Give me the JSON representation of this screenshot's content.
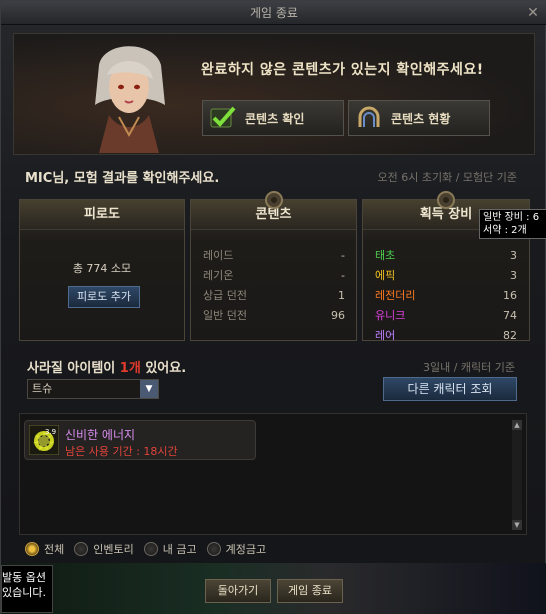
{
  "window": {
    "title": "게임 종료",
    "close_glyph": "✕"
  },
  "header": {
    "message": "완료하지 않은 콘텐츠가 있는지 확인해주세요!",
    "check_button": "콘텐츠 확인",
    "status_button": "콘텐츠 현황"
  },
  "summary": {
    "greeting": "MIC님, 모험 결과를 확인해주세요.",
    "reset_note": "오전 6시 초기화 / 모험단 기준"
  },
  "fatigue": {
    "title": "피로도",
    "usage_text": "총 774 소모",
    "add_button": "피로도 추가"
  },
  "content": {
    "title": "콘텐츠",
    "rows": [
      {
        "name": "레이드",
        "value": "-"
      },
      {
        "name": "레기온",
        "value": "-"
      },
      {
        "name": "상급 던전",
        "value": "1"
      },
      {
        "name": "일반 던전",
        "value": "96"
      }
    ]
  },
  "loot": {
    "title": "획득 장비",
    "rows": [
      {
        "name": "태초",
        "value": "3",
        "color": "#4fd04f"
      },
      {
        "name": "에픽",
        "value": "3",
        "color": "#f0c020"
      },
      {
        "name": "레전더리",
        "value": "16",
        "color": "#ff7a20"
      },
      {
        "name": "유니크",
        "value": "74",
        "color": "#e040e0"
      },
      {
        "name": "레어",
        "value": "82",
        "color": "#c080ff"
      }
    ]
  },
  "tooltip": {
    "line1": "일반 장비 : 6",
    "line2": "서약 : 2개"
  },
  "vanish": {
    "prefix": "사라질 아이템이 ",
    "count": "1개",
    "suffix": " 있어요.",
    "note": "3일내 / 캐릭터 기준",
    "select_value": "트슈",
    "other_char_button": "다른 캐릭터 조회"
  },
  "items": [
    {
      "name": "신비한 에너지",
      "time": "남은 사용 기간 : 18시간",
      "icon": "energy-orb-icon",
      "badge": "3.9"
    }
  ],
  "filters": [
    {
      "label": "전체",
      "selected": true
    },
    {
      "label": "인벤토리",
      "selected": false
    },
    {
      "label": "내 금고",
      "selected": false
    },
    {
      "label": "계정금고",
      "selected": false
    }
  ],
  "side_note": {
    "line1": "발동 옵션",
    "line2": "있습니다."
  },
  "footer": {
    "back_button": "돌아가기",
    "exit_button": "게임 종료"
  }
}
